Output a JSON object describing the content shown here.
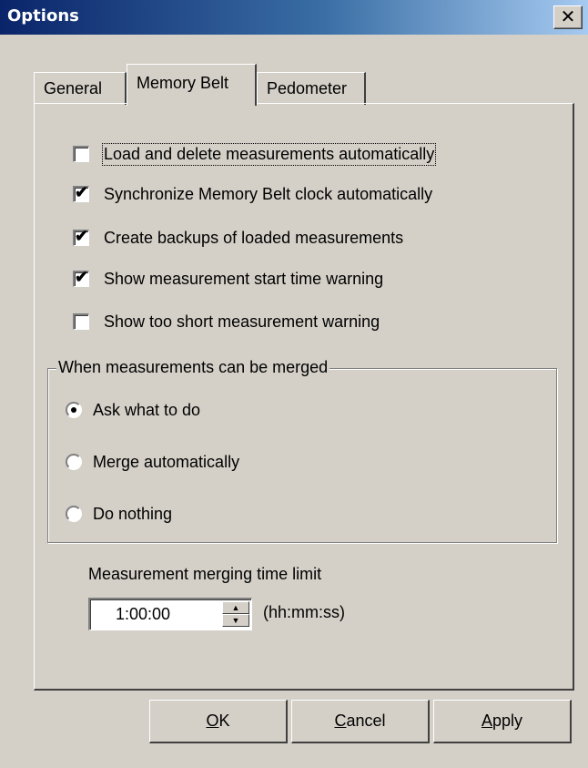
{
  "window": {
    "title": "Options",
    "close_glyph": "✕"
  },
  "tabs": [
    {
      "label": "General",
      "active": false
    },
    {
      "label": "Memory Belt",
      "active": true
    },
    {
      "label": "Pedometer",
      "active": false
    }
  ],
  "checkboxes": [
    {
      "label": "Load and delete measurements automatically",
      "checked": false
    },
    {
      "label": "Synchronize Memory Belt clock automatically",
      "checked": true
    },
    {
      "label": "Create backups of loaded measurements",
      "checked": true
    },
    {
      "label": "Show measurement start time warning",
      "checked": true
    },
    {
      "label": "Show too short measurement warning",
      "checked": false
    }
  ],
  "merge_group": {
    "title": "When measurements can be merged",
    "options": [
      {
        "label": "Ask what to do",
        "selected": true
      },
      {
        "label": "Merge automatically",
        "selected": false
      },
      {
        "label": "Do nothing",
        "selected": false
      }
    ]
  },
  "time_limit": {
    "label": "Measurement merging time limit",
    "value": "1:00:00",
    "unit": "(hh:mm:ss)"
  },
  "buttons": {
    "ok": {
      "mnemonic": "O",
      "rest": "K"
    },
    "cancel": {
      "mnemonic": "C",
      "rest": "ancel"
    },
    "apply": {
      "mnemonic": "A",
      "rest": "pply"
    }
  },
  "colors": {
    "face": "#d4d0c8",
    "title_start": "#0a246a",
    "title_end": "#a6caf0"
  }
}
